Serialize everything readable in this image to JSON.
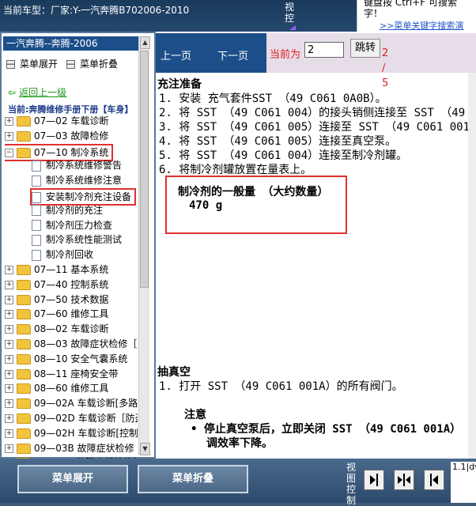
{
  "header": {
    "car_label": "当前车型：厂家:Y-一汽奔腾B702006-2010",
    "view_ctrl": "视控",
    "search_text": "键盘按 Ctrl+F 可搜索字！",
    "search_link": ">>菜单关键字搜索演"
  },
  "sidebar": {
    "title": "一汽奔腾--奔腾-2006",
    "expand_label": "菜单展开",
    "collapse_label": "菜单折叠",
    "back_label": "返回上一级",
    "current": "当前:奔腾维修手册下册【车身】",
    "tree": [
      {
        "label": "07—02 车载诊断",
        "type": "folder"
      },
      {
        "label": "07—03 故障检修",
        "type": "folder"
      },
      {
        "label": "07—10 制冷系统",
        "type": "folder-open"
      },
      {
        "label": "制冷系统维修警告",
        "type": "doc"
      },
      {
        "label": "制冷系统维修注意",
        "type": "doc"
      },
      {
        "label": "安装制冷剂充注设备",
        "type": "doc"
      },
      {
        "label": "制冷剂的充注",
        "type": "doc"
      },
      {
        "label": "制冷剂压力检查",
        "type": "doc"
      },
      {
        "label": "制冷系统性能测试",
        "type": "doc"
      },
      {
        "label": "制冷剂回收",
        "type": "doc"
      },
      {
        "label": "07—11 基本系统",
        "type": "folder"
      },
      {
        "label": "07—40 控制系统",
        "type": "folder"
      },
      {
        "label": "07—50 技术数据",
        "type": "folder"
      },
      {
        "label": "07—60 维修工具",
        "type": "folder"
      },
      {
        "label": "08—02 车载诊断",
        "type": "folder"
      },
      {
        "label": "08—03 故障症状检修［安",
        "type": "folder"
      },
      {
        "label": "08—10 安全气囊系统",
        "type": "folder"
      },
      {
        "label": "08—11 座椅安全带",
        "type": "folder"
      },
      {
        "label": "08—60 维修工具",
        "type": "folder"
      },
      {
        "label": "09—02A 车载诊断[多路",
        "type": "folder"
      },
      {
        "label": "09—02D 车载诊断［防盗",
        "type": "folder"
      },
      {
        "label": "09—02H 车载诊断[控制",
        "type": "folder"
      },
      {
        "label": "09—03B 故障症状检修",
        "type": "folder"
      },
      {
        "label": "09—03F 故障症状检修[",
        "type": "folder"
      },
      {
        "label": "09—03C 故障症状检修",
        "type": "folder"
      }
    ]
  },
  "nav": {
    "prev": "上一页",
    "next": "下一页",
    "page_label": "当前为",
    "page_value": "2",
    "jump": "跳转",
    "page_total": "2 / 5"
  },
  "doc": {
    "section1_title": "充注准备",
    "steps": [
      "1. 安装 充气套件SST （49 C061 0A0B）。",
      "2. 将 SST （49 C061 004）的接头销侧连接至 SST （49",
      "3. 将 SST （49 C061 005）连接至 SST （49 C061 001A）",
      "4. 将 SST （49 C061 005）连接至真空泵。",
      "5. 将 SST （49 C061 004）连接至制冷剂罐。",
      "6. 将制冷剂罐放置在量表上。"
    ],
    "ref_title": "制冷剂的一般量 （大约数量）",
    "ref_value": "470 g",
    "section2_title": "抽真空",
    "step2_1": "1. 打开 SST （49 C061 001A）的所有阀门。",
    "note_title": "注意",
    "note_line1": "• 停止真空泵后，立即关闭 SST （49 C061 001A）",
    "note_line2": "调效率下降。"
  },
  "bottom": {
    "expand": "菜单展开",
    "collapse": "菜单折叠",
    "view": "视图控制",
    "info": "1.1|dv"
  }
}
